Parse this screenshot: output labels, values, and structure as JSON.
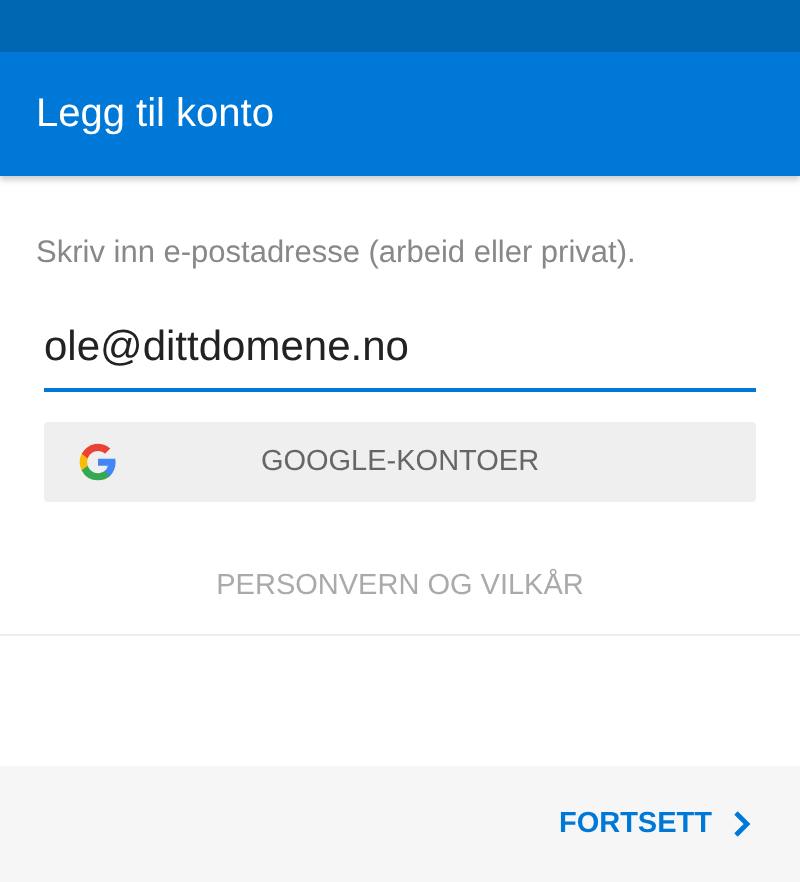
{
  "app_bar": {
    "title": "Legg til konto"
  },
  "prompt": "Skriv inn e-postadresse (arbeid eller privat).",
  "email_field": {
    "value": "ole@dittdomene.no",
    "focused": true
  },
  "google_button": {
    "label": "GOOGLE-KONTOER"
  },
  "privacy_link": "PERSONVERN OG VILKÅR",
  "footer": {
    "continue_button": "FORTSETT"
  }
}
